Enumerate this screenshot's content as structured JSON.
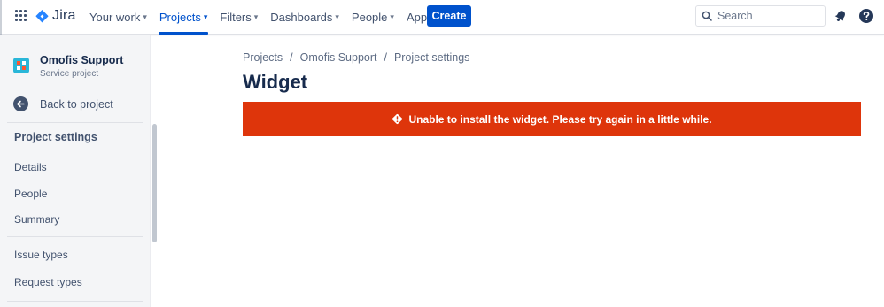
{
  "topnav": {
    "logo_text": "Jira",
    "items": [
      {
        "label": "Your work",
        "active": false
      },
      {
        "label": "Projects",
        "active": true
      },
      {
        "label": "Filters",
        "active": false
      },
      {
        "label": "Dashboards",
        "active": false
      },
      {
        "label": "People",
        "active": false
      },
      {
        "label": "Apps",
        "active": false
      }
    ],
    "create_label": "Create",
    "search_placeholder": "Search",
    "icons": [
      "app-switcher-icon",
      "jira-logo-icon",
      "search-icon",
      "notification-bell-icon",
      "help-icon"
    ],
    "accent_color": "#0052CC"
  },
  "sidebar": {
    "project_name": "Omofis Support",
    "project_type": "Service project",
    "back_label": "Back to project",
    "section_title": "Project settings",
    "items": [
      {
        "label": "Details"
      },
      {
        "label": "People"
      },
      {
        "label": "Summary"
      },
      {
        "label": "Issue types"
      },
      {
        "label": "Request types"
      }
    ]
  },
  "main": {
    "breadcrumb": [
      "Projects",
      "Omofis Support",
      "Project settings"
    ],
    "breadcrumb_separator": "/",
    "title": "Widget",
    "error_message": "Unable to install the widget. Please try again in a little while.",
    "error_color": "#DE350B"
  }
}
